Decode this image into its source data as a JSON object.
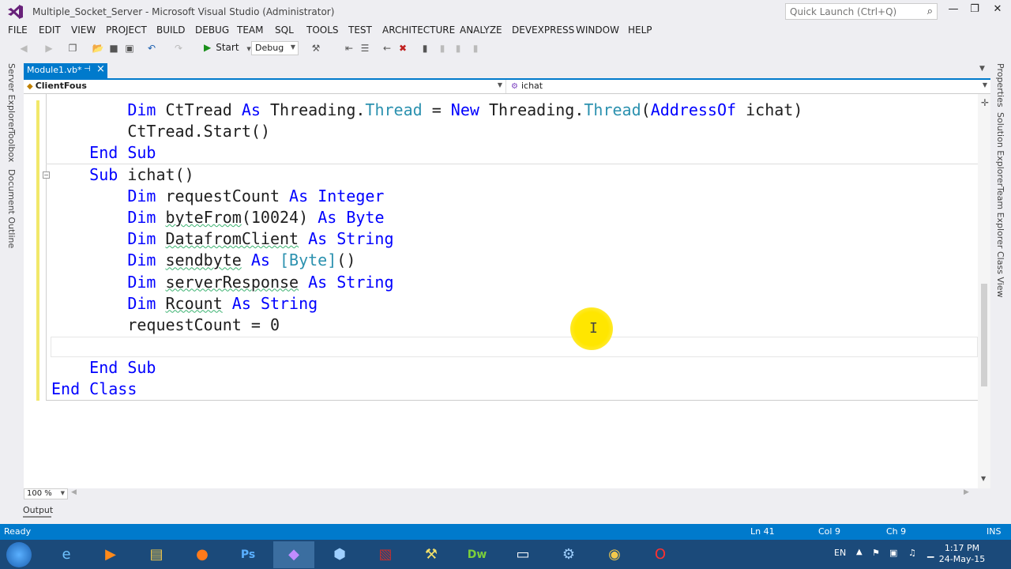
{
  "window": {
    "title": "Multiple_Socket_Server - Microsoft Visual Studio (Administrator)",
    "quick_launch_placeholder": "Quick Launch (Ctrl+Q)"
  },
  "menu": [
    "FILE",
    "EDIT",
    "VIEW",
    "PROJECT",
    "BUILD",
    "DEBUG",
    "TEAM",
    "SQL",
    "TOOLS",
    "TEST",
    "ARCHITECTURE",
    "ANALYZE",
    "DEVEXPRESS",
    "WINDOW",
    "HELP"
  ],
  "toolbar": {
    "start_label": "Start",
    "config_value": "Debug"
  },
  "left_tabs": [
    "Server Explorer",
    "Toolbox",
    "Document Outline"
  ],
  "right_tabs": [
    "Properties",
    "Solution Explorer",
    "Team Explorer",
    "Class View"
  ],
  "document_tab": {
    "label": "Module1.vb*"
  },
  "navigation": {
    "class_value": "ClientFous",
    "member_value": "ichat"
  },
  "code_lines": [
    "        Dim CtTread As Threading.Thread = New Threading.Thread(AddressOf ichat)",
    "        CtTread.Start()",
    "    End Sub",
    "    Sub ichat()",
    "        Dim requestCount As Integer",
    "        Dim byteFrom(10024) As Byte",
    "        Dim DatafromClient As String",
    "        Dim sendbyte As [Byte]()",
    "        Dim serverResponse As String",
    "        Dim Rcount As String",
    "        requestCount = 0",
    "",
    "    End Sub",
    "End Class"
  ],
  "zoom": "100 %",
  "output_tab": "Output",
  "status": {
    "state": "Ready",
    "line": "Ln 41",
    "col": "Col 9",
    "ch": "Ch 9",
    "mode": "INS"
  },
  "taskbar": {
    "language": "EN",
    "time": "1:17 PM",
    "date": "24-May-15"
  },
  "colors": {
    "accent": "#007acc",
    "keyword": "#0000ff",
    "type": "#2b91af"
  }
}
